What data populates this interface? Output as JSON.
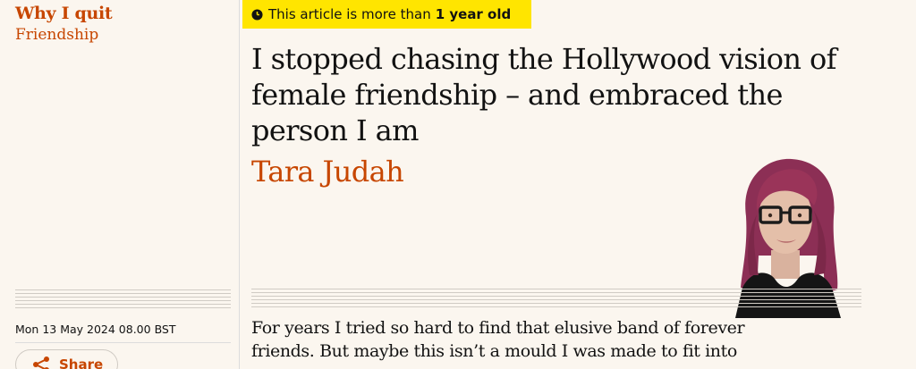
{
  "series": {
    "title": "Why I quit",
    "subtitle": "Friendship"
  },
  "meta": {
    "dateline": "Mon 13 May 2024 08.00 BST",
    "share_label": "Share"
  },
  "age_badge": {
    "text": "This article is more than",
    "emphasis": "1 year old",
    "icon": "clock-icon"
  },
  "article": {
    "headline": "I stopped chasing the Hollywood vision of female friendship – and embraced the person I am",
    "byline": "Tara Judah",
    "standfirst": "For years I tried so hard to find that elusive band of forever friends. But maybe this isn’t a mould I was made to fit into"
  },
  "colors": {
    "accent": "#c74600",
    "badge": "#ffe500",
    "background": "#fbf6ef"
  }
}
